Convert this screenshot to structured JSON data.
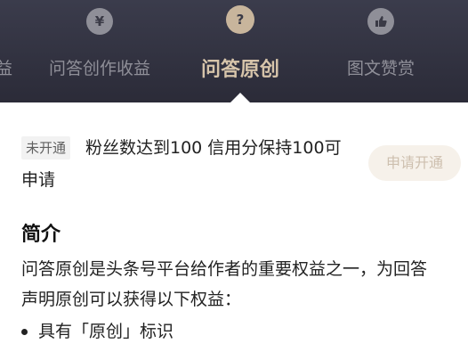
{
  "tabs": [
    {
      "label": "收益",
      "icon": "yuan-icon",
      "glyph": ""
    },
    {
      "label": "问答创作收益",
      "icon": "yuan-icon",
      "glyph": "¥"
    },
    {
      "label": "问答原创",
      "icon": "question-icon",
      "glyph": "?",
      "active": true
    },
    {
      "label": "图文赞赏",
      "icon": "thumbs-up-icon",
      "glyph": "👍"
    }
  ],
  "requirement": {
    "status_badge": "未开通",
    "line1": "粉丝数达到100 信用分保持100可",
    "line2": "申请",
    "apply_button": "申请开通"
  },
  "intro": {
    "title": "简介",
    "line1": "问答原创是头条号平台给作者的重要权益之一，为回答",
    "line2": "声明原创可以获得以下权益：",
    "bullets": [
      "具有「原创」标识"
    ]
  },
  "colors": {
    "header_bg": "#2f2f3d",
    "active_label": "#d6c4aa",
    "inactive_label": "#8f8f98",
    "apply_button_bg": "#f6f1ea"
  }
}
